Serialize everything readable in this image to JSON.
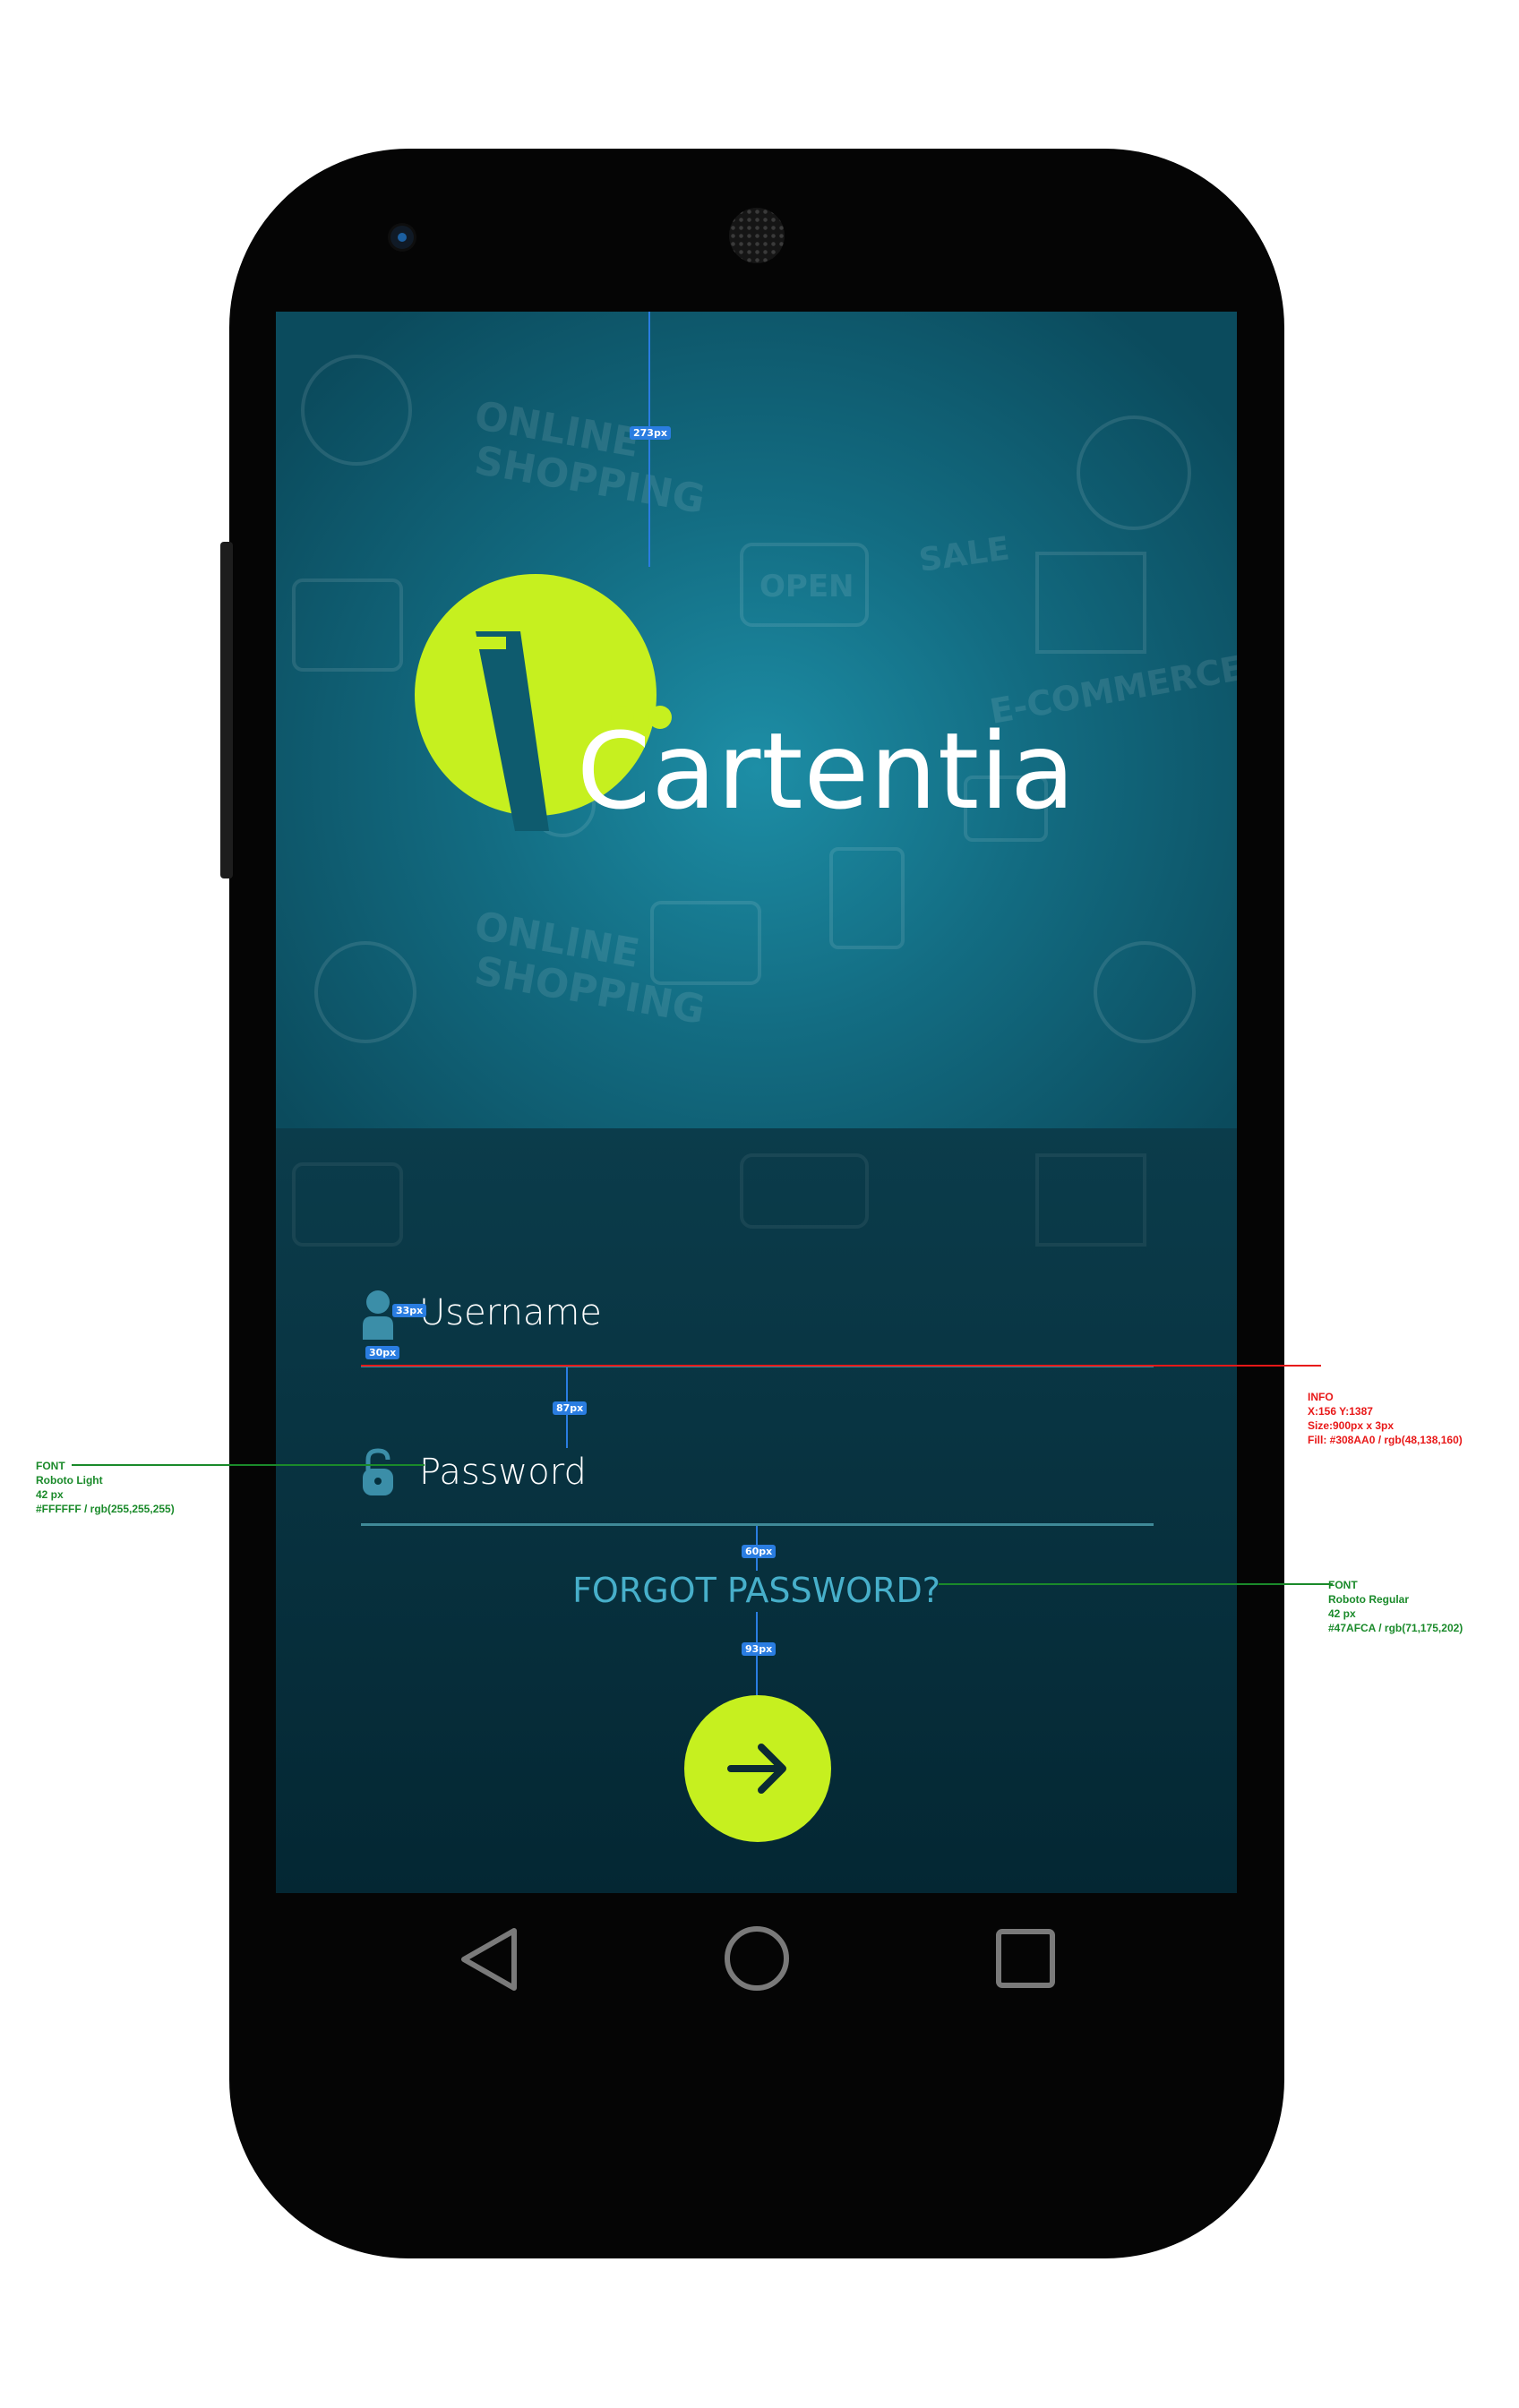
{
  "app": {
    "name": "Cartentia",
    "colors": {
      "accent": "#C6F01F",
      "link": "#47AFCA",
      "underline": "#308AA0",
      "hero": "#136D83",
      "form_bg": "#04303D"
    }
  },
  "hero": {
    "logo_text": "Cartentia",
    "logo_icon": "cart-logo-icon",
    "pattern_words": [
      "ONLINE",
      "SHOPPING",
      "OPEN",
      "SALE",
      "E-COMMERCE",
      "ONLINE",
      "SHOPPING"
    ]
  },
  "form": {
    "username": {
      "placeholder": "Username",
      "icon": "user-icon"
    },
    "password": {
      "placeholder": "Password",
      "icon": "unlock-icon"
    },
    "forgot_label": "FORGOT PASSWORD?",
    "submit_icon": "arrow-right-icon"
  },
  "nav_bar": {
    "icons": [
      "back-triangle-icon",
      "home-circle-icon",
      "recents-square-icon"
    ]
  },
  "annotations": {
    "badges": {
      "top_margin": "273px",
      "icon_size": "33px",
      "icon_gap": "30px",
      "field_spacing": "87px",
      "forgot_spacing": "60px",
      "button_spacing": "93px"
    },
    "font_note_left": {
      "title": "FONT",
      "family": "Roboto Light",
      "size": "42 px",
      "color": "#FFFFFF / rgb(255,255,255)"
    },
    "info_note": {
      "title": "INFO",
      "position": "X:156  Y:1387",
      "size": "Size:900px x 3px",
      "fill": "Fill: #308AA0 / rgb(48,138,160)"
    },
    "font_note_right": {
      "title": "FONT",
      "family": "Roboto Regular",
      "size": "42 px",
      "color": "#47AFCA / rgb(71,175,202)"
    }
  }
}
